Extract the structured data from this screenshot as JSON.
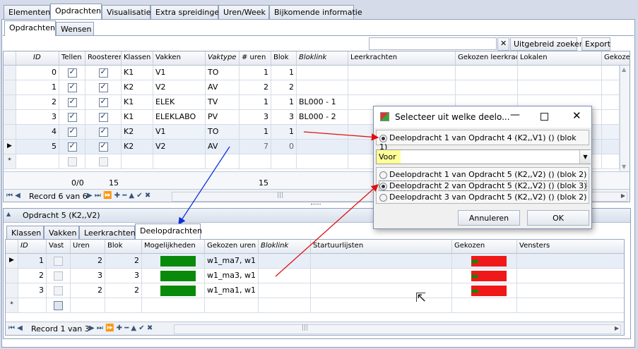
{
  "main_tabs": [
    "Elementen",
    "Opdrachten",
    "Visualisatie",
    "Extra spreidingen",
    "Uren/Week",
    "Bijkomende informatie"
  ],
  "sub_tabs": [
    "Opdrachten",
    "Wensen"
  ],
  "toolbar": {
    "search_value": "",
    "clear_label": "✕",
    "advanced_search": "Uitgebreid zoeken",
    "export": "Export"
  },
  "top_grid": {
    "columns": [
      "ID",
      "Tellen",
      "Roosteren",
      "Klassen",
      "Vakken",
      "Vaktype",
      "# uren",
      "Blok",
      "Bloklink",
      "Leerkrachten",
      "Gekozen leerkrac...",
      "Lokalen",
      "Gekozen"
    ],
    "rows": [
      {
        "id": "0",
        "tellen": true,
        "roosteren": true,
        "klassen": "K1",
        "vakken": "V1",
        "vaktype": "TO",
        "uren": "1",
        "blok": "1",
        "bloklink": ""
      },
      {
        "id": "1",
        "tellen": true,
        "roosteren": true,
        "klassen": "K2",
        "vakken": "V2",
        "vaktype": "AV",
        "uren": "2",
        "blok": "2",
        "bloklink": ""
      },
      {
        "id": "2",
        "tellen": true,
        "roosteren": true,
        "klassen": "K1",
        "vakken": "ELEK",
        "vaktype": "TV",
        "uren": "1",
        "blok": "1",
        "bloklink": "BL000 - 1"
      },
      {
        "id": "3",
        "tellen": true,
        "roosteren": true,
        "klassen": "K1",
        "vakken": "ELEKLABO",
        "vaktype": "PV",
        "uren": "3",
        "blok": "3",
        "bloklink": "BL000 - 2"
      },
      {
        "id": "4",
        "tellen": true,
        "roosteren": true,
        "klassen": "K2",
        "vakken": "V1",
        "vaktype": "TO",
        "uren": "1",
        "blok": "1",
        "bloklink": ""
      },
      {
        "id": "5",
        "tellen": true,
        "roosteren": true,
        "klassen": "K2",
        "vakken": "V2",
        "vaktype": "AV",
        "uren": "7",
        "blok": "0",
        "bloklink": ""
      }
    ],
    "new_row_marker": "*",
    "footer": {
      "tellen_sum": "0/0",
      "roosteren_sum": "15",
      "uren_sum": "15"
    },
    "record_label": "Record 6 van 6"
  },
  "detail": {
    "title": "Opdracht 5 (K2,,V2)",
    "tabs": [
      "Klassen",
      "Vakken",
      "Leerkrachten",
      "Deelopdrachten"
    ],
    "columns": [
      "ID",
      "Vast",
      "Uren",
      "Blok",
      "Mogelijkheden",
      "Gekozen uren",
      "Bloklink",
      "Startuurlijsten",
      "Gekozen",
      "Vensters"
    ],
    "rows": [
      {
        "id": "1",
        "vast": false,
        "uren": "2",
        "blok": "2",
        "gekozen_uren": "w1_ma7, w1"
      },
      {
        "id": "2",
        "vast": false,
        "uren": "3",
        "blok": "3",
        "gekozen_uren": "w1_ma3, w1"
      },
      {
        "id": "3",
        "vast": false,
        "uren": "2",
        "blok": "2",
        "gekozen_uren": "w1_ma1, w1"
      }
    ],
    "record_label": "Record 1 van 3"
  },
  "dialog": {
    "title": "Selecteer uit welke deelo...",
    "source_option": "Deelopdracht 1 van Opdracht 4 (K2,,V1) () (blok 1)",
    "dropdown_value": "Voor",
    "options": [
      "Deelopdracht 1 van Opdracht 5 (K2,,V2) () (blok 2)",
      "Deelopdracht 2 van Opdracht 5 (K2,,V2) () (blok 3)",
      "Deelopdracht 3 van Opdracht 5 (K2,,V2) () (blok 2)"
    ],
    "selected_index": 1,
    "cancel": "Annuleren",
    "ok": "OK"
  },
  "colors": {
    "accent": "#ffff99",
    "bar_green": "#0a8a0a",
    "bar_red": "#f01818",
    "arrow_red": "#e01010",
    "arrow_blue": "#1030d8"
  }
}
